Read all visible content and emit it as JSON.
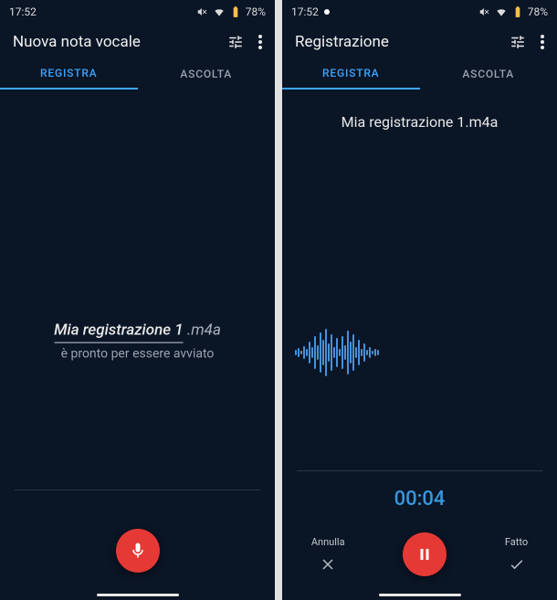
{
  "left": {
    "status": {
      "time": "17:52",
      "battery": "78%"
    },
    "app_title": "Nuova nota vocale",
    "tabs": {
      "registra": "REGISTRA",
      "ascolta": "ASCOLTA"
    },
    "filename_base": "Mia registrazione 1",
    "filename_ext": ".m4a",
    "subtitle": "è pronto per essere avviato"
  },
  "right": {
    "status": {
      "time": "17:52",
      "battery": "78%"
    },
    "app_title": "Registrazione",
    "tabs": {
      "registra": "REGISTRA",
      "ascolta": "ASCOLTA"
    },
    "filename": "Mia registrazione 1.m4a",
    "timer": "00:04",
    "cancel_label": "Annulla",
    "done_label": "Fatto"
  }
}
